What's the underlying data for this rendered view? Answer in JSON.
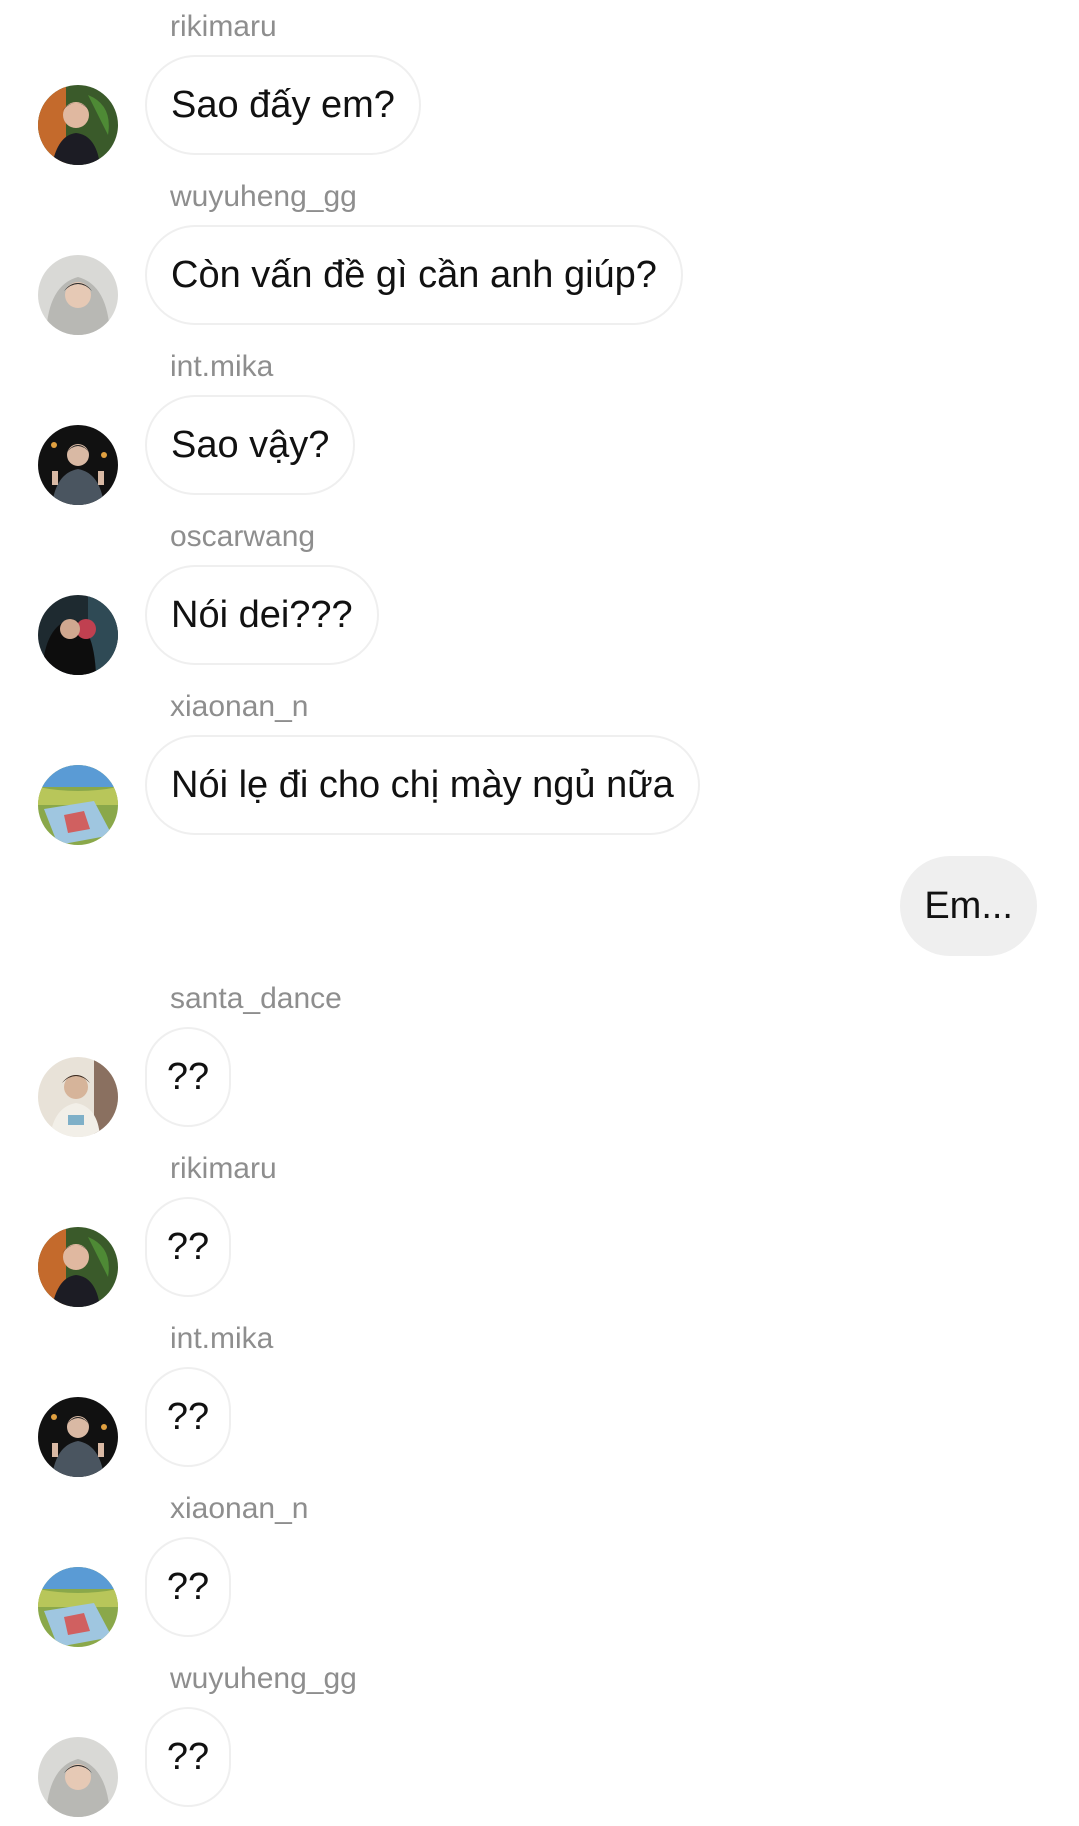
{
  "messages": [
    {
      "sender": "rikimaru",
      "text": "Sao đấy em?"
    },
    {
      "sender": "wuyuheng_gg",
      "text": "Còn vấn đề gì cần anh giúp?"
    },
    {
      "sender": "int.mika",
      "text": "Sao vậy?"
    },
    {
      "sender": "oscarwang",
      "text": "Nói dei???"
    },
    {
      "sender": "xiaonan_n",
      "text": "Nói lẹ đi cho chị mày ngủ nữa"
    },
    {
      "sender": "me",
      "text": "Em..."
    },
    {
      "sender": "santa_dance",
      "text": "??"
    },
    {
      "sender": "rikimaru",
      "text": "??"
    },
    {
      "sender": "int.mika",
      "text": "??"
    },
    {
      "sender": "xiaonan_n",
      "text": "??"
    },
    {
      "sender": "wuyuheng_gg",
      "text": "??"
    }
  ],
  "colors": {
    "sender_name": "#8e8e8e",
    "bubble_border": "#efefef",
    "own_bubble": "#efefef",
    "text": "#111111"
  }
}
